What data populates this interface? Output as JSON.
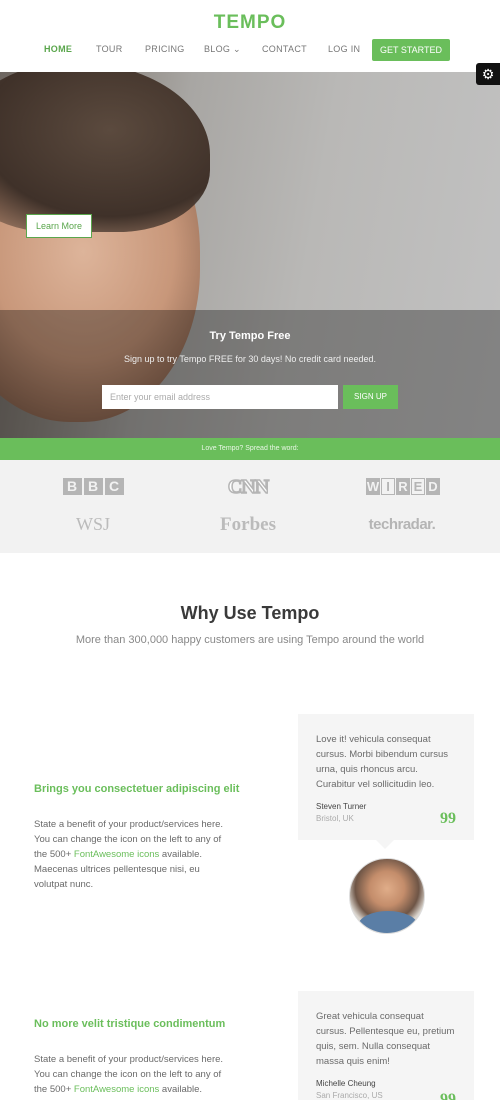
{
  "header": {
    "logo": "TEMPO",
    "nav": [
      {
        "label": "HOME",
        "active": true
      },
      {
        "label": "TOUR",
        "active": false
      },
      {
        "label": "PRICING",
        "active": false
      },
      {
        "label": "BLOG ⌄",
        "active": false
      },
      {
        "label": "CONTACT",
        "active": false
      },
      {
        "label": "LOG IN",
        "active": false
      }
    ],
    "cta": "GET STARTED",
    "settings_icon": "gear-icon"
  },
  "hero": {
    "learn_more": "Learn More",
    "title": "Try Tempo Free",
    "subtitle": "Sign up to try Tempo FREE for 30 days! No credit card needed.",
    "email_placeholder": "Enter your email address",
    "signup": "SIGN UP",
    "share_text": "Love Tempo? Spread the word:"
  },
  "logos": {
    "bbc": [
      "B",
      "B",
      "C"
    ],
    "cnn": "CNN",
    "wired": [
      "W",
      "I",
      "R",
      "E",
      "D"
    ],
    "wsj": "WSJ",
    "forbes": "Forbes",
    "techradar": "techradar."
  },
  "why": {
    "title": "Why Use Tempo",
    "subtitle": "More than 300,000 happy customers are using Tempo around the world"
  },
  "features": [
    {
      "title": "Brings you consectetuer adipiscing elit",
      "text_before": "State a benefit of your product/services here. You can change the icon on the left to any of the 500+ ",
      "link": "FontAwesome icons",
      "text_after": " available. Maecenas ultrices pellentesque nisi, eu volutpat nunc."
    },
    {
      "title": "No more velit tristique condimentum",
      "text_before": "State a benefit of your product/services here. You can change the icon on the left to any of the 500+ ",
      "link": "FontAwesome icons",
      "text_after": " available."
    }
  ],
  "testimonials": [
    {
      "text": "Love it! vehicula consequat cursus. Morbi bibendum cursus urna, quis rhoncus arcu. Curabitur vel sollicitudin leo.",
      "name": "Steven Turner",
      "location": "Bristol, UK"
    },
    {
      "text": "Great vehicula consequat cursus. Pellentesque eu, pretium quis, sem. Nulla consequat massa quis enim!",
      "name": "Michelle Cheung",
      "location": "San Francisco, US"
    }
  ],
  "quote_mark": "99",
  "colors": {
    "accent": "#6abe5b",
    "heading": "#3a3a3a"
  }
}
